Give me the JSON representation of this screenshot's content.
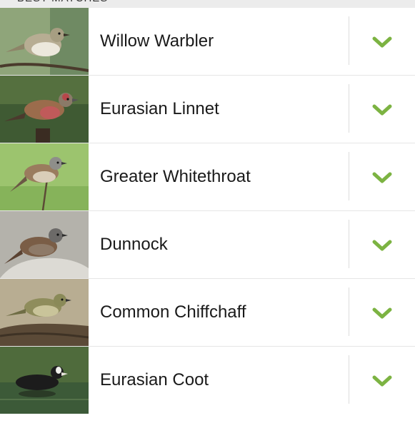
{
  "section": {
    "header": "BEST MATCHES"
  },
  "colors": {
    "accent": "#7cb342",
    "divider": "#dcdcdc",
    "header_bg": "#ececec"
  },
  "birds": [
    {
      "name": "Willow Warbler",
      "expand_icon": "chevron-down-icon"
    },
    {
      "name": "Eurasian Linnet",
      "expand_icon": "chevron-down-icon"
    },
    {
      "name": "Greater Whitethroat",
      "expand_icon": "chevron-down-icon"
    },
    {
      "name": "Dunnock",
      "expand_icon": "chevron-down-icon"
    },
    {
      "name": "Common Chiffchaff",
      "expand_icon": "chevron-down-icon"
    },
    {
      "name": "Eurasian Coot",
      "expand_icon": "chevron-down-icon"
    }
  ]
}
